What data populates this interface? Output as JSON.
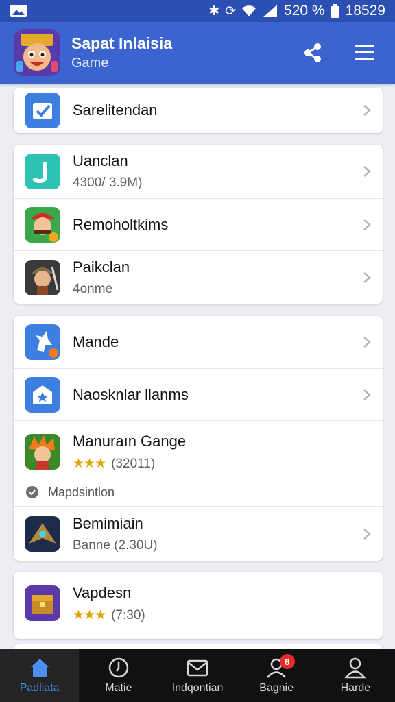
{
  "status_bar": {
    "battery_text": "520 %",
    "time": "18529"
  },
  "app_bar": {
    "title": "Sapat Inlaisia",
    "subtitle": "Game",
    "share_icon": "share-icon",
    "menu_icon": "hamburger-menu-icon"
  },
  "cards": [
    {
      "items": [
        {
          "title": "Sarelitendan",
          "icon": "checkbox-icon",
          "color": "#3d7fe0"
        }
      ]
    },
    {
      "items": [
        {
          "title": "Uanclan",
          "subtitle": "4300/ 3.9M)",
          "icon": "j-app-icon",
          "color": "#2ec2b4"
        },
        {
          "title": "Remoholtkims",
          "icon": "game-mario-icon"
        },
        {
          "title": "Paikclan",
          "subtitle": "4onme",
          "icon": "game-warrior-icon"
        }
      ]
    },
    {
      "items": [
        {
          "title": "Mande",
          "icon": "unicorn-app-icon",
          "color": "#3d7fe0"
        },
        {
          "title": "Naosknlar llanms",
          "icon": "envelope-star-icon",
          "color": "#3d7fe0"
        },
        {
          "title": "Manuraın Gange",
          "stars": "★★★",
          "rating_count": "(32011)",
          "icon": "game-hero-icon",
          "extra": "Mapdsintlon"
        },
        {
          "title": "Bemimiain",
          "subtitle": "Banne (2.30U)",
          "icon": "game-spaceship-icon"
        }
      ]
    },
    {
      "items": [
        {
          "title": "Vapdesn",
          "stars": "★★★",
          "rating_count": "(7:30)",
          "icon": "game-chest-icon"
        }
      ]
    }
  ],
  "bottom_nav": [
    {
      "label": "Padliata",
      "icon": "home-icon",
      "active": true
    },
    {
      "label": "Matie",
      "icon": "clock-icon"
    },
    {
      "label": "Indqontian",
      "icon": "mail-icon"
    },
    {
      "label": "Bagnie",
      "icon": "notification-person-icon",
      "badge": "8"
    },
    {
      "label": "Harde",
      "icon": "profile-icon"
    }
  ],
  "colors": {
    "app_bar": "#3b64d0",
    "status_bar": "#2c4fb4",
    "nav_active": "#4d8ef0",
    "star": "#e0a400",
    "badge": "#e42b2b"
  }
}
